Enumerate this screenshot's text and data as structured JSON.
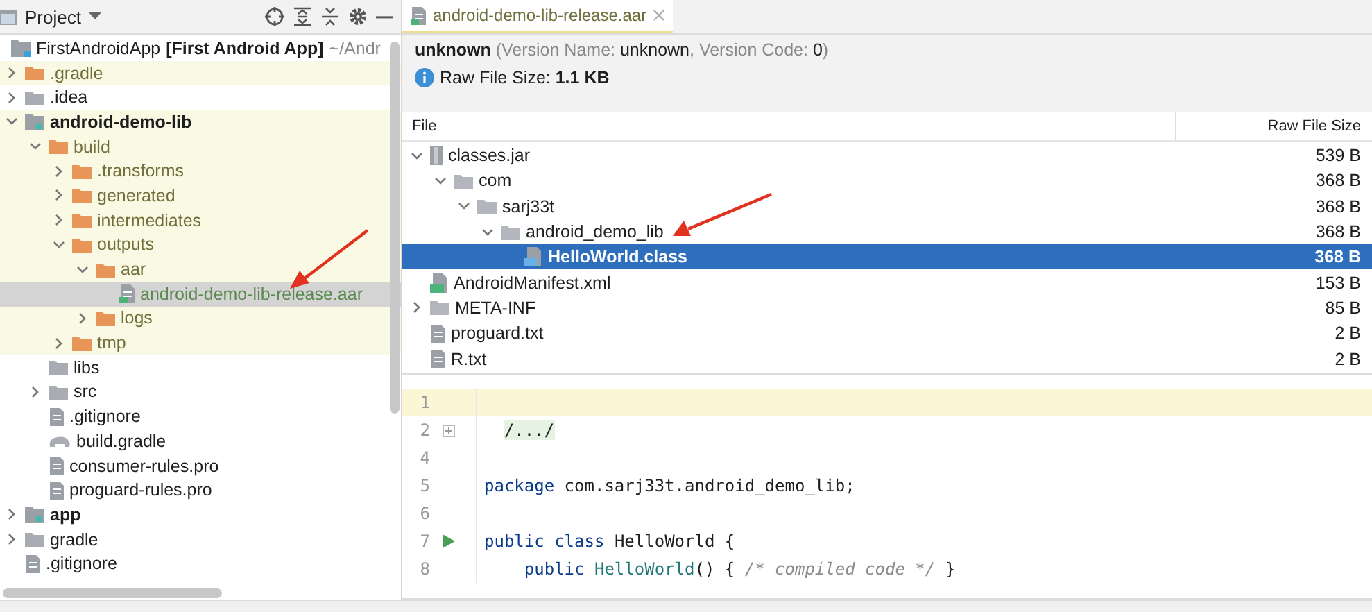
{
  "project_panel": {
    "title": "Project",
    "root": {
      "label": "FirstAndroidApp",
      "tag": "[First Android App]",
      "path": "~/Andr",
      "kind": "project",
      "bold": false,
      "selected": false,
      "highlighted": false,
      "children": [
        {
          "label": ".gradle",
          "kind": "folder-orange",
          "expanded": false,
          "bold": false,
          "selected": false,
          "highlighted": true
        },
        {
          "label": ".idea",
          "kind": "folder-grey",
          "expanded": false,
          "bold": false,
          "selected": false,
          "highlighted": false
        },
        {
          "label": "android-demo-lib",
          "kind": "module",
          "expanded": true,
          "bold": true,
          "selected": false,
          "highlighted": true,
          "children": [
            {
              "label": "build",
              "kind": "folder-orange",
              "expanded": true,
              "bold": false,
              "selected": false,
              "highlighted": true,
              "children": [
                {
                  "label": ".transforms",
                  "kind": "folder-orange",
                  "expanded": false,
                  "bold": false,
                  "selected": false,
                  "highlighted": true
                },
                {
                  "label": "generated",
                  "kind": "folder-orange",
                  "expanded": false,
                  "bold": false,
                  "selected": false,
                  "highlighted": true
                },
                {
                  "label": "intermediates",
                  "kind": "folder-orange",
                  "expanded": false,
                  "bold": false,
                  "selected": false,
                  "highlighted": true
                },
                {
                  "label": "outputs",
                  "kind": "folder-orange",
                  "expanded": true,
                  "bold": false,
                  "selected": false,
                  "highlighted": true,
                  "children": [
                    {
                      "label": "aar",
                      "kind": "folder-orange",
                      "expanded": true,
                      "bold": false,
                      "selected": false,
                      "highlighted": true,
                      "children": [
                        {
                          "label": "android-demo-lib-release.aar",
                          "kind": "archive",
                          "bold": false,
                          "selected": true
                        }
                      ]
                    },
                    {
                      "label": "logs",
                      "kind": "folder-orange",
                      "expanded": false,
                      "bold": false,
                      "selected": false,
                      "highlighted": true
                    }
                  ]
                },
                {
                  "label": "tmp",
                  "kind": "folder-orange",
                  "expanded": false,
                  "bold": false,
                  "selected": false,
                  "highlighted": true
                }
              ]
            },
            {
              "label": "libs",
              "kind": "folder-grey",
              "bold": false,
              "selected": false,
              "highlighted": false
            },
            {
              "label": "src",
              "kind": "folder-grey",
              "expanded": false,
              "bold": false,
              "selected": false,
              "highlighted": false
            },
            {
              "label": ".gitignore",
              "kind": "ignore-file",
              "bold": false,
              "selected": false,
              "highlighted": false
            },
            {
              "label": "build.gradle",
              "kind": "gradle-file",
              "bold": false,
              "selected": false,
              "highlighted": false
            },
            {
              "label": "consumer-rules.pro",
              "kind": "text-file",
              "bold": false,
              "selected": false,
              "highlighted": false
            },
            {
              "label": "proguard-rules.pro",
              "kind": "text-file",
              "bold": false,
              "selected": false,
              "highlighted": false
            }
          ]
        },
        {
          "label": "app",
          "kind": "module",
          "expanded": false,
          "bold": true,
          "selected": false,
          "highlighted": false
        },
        {
          "label": "gradle",
          "kind": "folder-grey",
          "expanded": false,
          "bold": false,
          "selected": false,
          "highlighted": false
        },
        {
          "label": ".gitignore",
          "kind": "ignore-file",
          "bold": false,
          "selected": false,
          "highlighted": false
        }
      ]
    }
  },
  "editor_tab": {
    "label": "android-demo-lib-release.aar",
    "selected": true
  },
  "summary": {
    "app_id": "unknown",
    "version_parts": [
      {
        "text": "(Version Name: ",
        "muted": true
      },
      {
        "text": "unknown",
        "muted": false
      },
      {
        "text": ", Version Code: ",
        "muted": true
      },
      {
        "text": "0",
        "muted": false
      },
      {
        "text": ")",
        "muted": true
      }
    ],
    "raw_size": "Raw File Size: **1.1 KB**"
  },
  "table": {
    "columns": [
      "File",
      "Raw File Size"
    ],
    "rows": [
      {
        "name": "classes.jar",
        "size": "539 B",
        "kind": "jar",
        "expanded": true,
        "selected": false,
        "children": [
          {
            "name": "com",
            "size": "368 B",
            "kind": "package",
            "expanded": true,
            "selected": false,
            "children": [
              {
                "name": "sarj33t",
                "size": "368 B",
                "kind": "package",
                "expanded": true,
                "selected": false,
                "children": [
                  {
                    "name": "android_demo_lib",
                    "size": "368 B",
                    "kind": "package",
                    "expanded": true,
                    "selected": false,
                    "children": [
                      {
                        "name": "HelloWorld.class",
                        "size": "368 B",
                        "kind": "class",
                        "selected": true
                      }
                    ]
                  }
                ]
              }
            ]
          }
        ]
      },
      {
        "name": "AndroidManifest.xml",
        "size": "153 B",
        "kind": "manifest",
        "selected": false
      },
      {
        "name": "META-INF",
        "size": "85 B",
        "kind": "package",
        "expanded": false,
        "selected": false
      },
      {
        "name": "proguard.txt",
        "size": "2 B",
        "kind": "text",
        "selected": false
      },
      {
        "name": "R.txt",
        "size": "2 B",
        "kind": "text",
        "selected": false
      }
    ]
  },
  "code": {
    "lines": [
      {
        "number": "1",
        "current": true
      },
      {
        "number": "2",
        "current": false,
        "fold": true,
        "tokens": [
          {
            "text": "/.../",
            "kind": "folded"
          }
        ]
      },
      {
        "number": "4",
        "current": false
      },
      {
        "number": "5",
        "current": false,
        "tokens": [
          {
            "text": "package",
            "kind": "keyword"
          },
          {
            "text": " com.sarj33t.android_demo_lib;",
            "kind": "plain"
          }
        ]
      },
      {
        "number": "6",
        "current": false
      },
      {
        "number": "7",
        "current": false,
        "run": true,
        "tokens": [
          {
            "text": "public",
            "kind": "keyword"
          },
          {
            "text": " class",
            "kind": "keyword"
          },
          {
            "text": " HelloWorld {",
            "kind": "plain"
          }
        ]
      },
      {
        "number": "8",
        "current": false,
        "tokens": [
          {
            "text": "    public",
            "kind": "keyword"
          },
          {
            "text": " HelloWorld",
            "kind": "method"
          },
          {
            "text": "() { ",
            "kind": "plain"
          },
          {
            "text": "/* compiled code */",
            "kind": "comment"
          },
          {
            "text": " }",
            "kind": "plain"
          }
        ]
      }
    ]
  }
}
